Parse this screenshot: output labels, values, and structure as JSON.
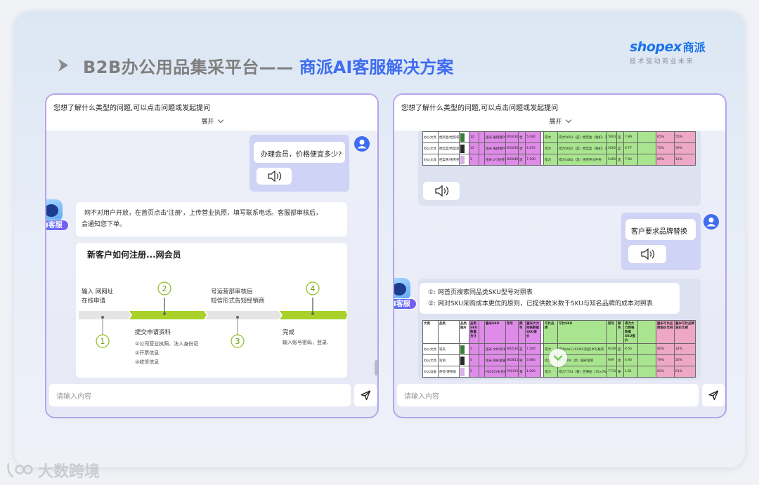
{
  "slide": {
    "title_main": "B2B办公用品集采平台——",
    "title_accent": "商派AI客服解决方案",
    "logo_en": "shopex",
    "logo_cn": "商派",
    "logo_tagline": "技术驱动商业未来"
  },
  "left_panel": {
    "header_prompt": "您想了解什么类型的问题,可以点击问题或发起提问",
    "expand_label": "展开",
    "user_message": "办理会员，价格便宜多少?",
    "ai_badge": "AI客服",
    "bot_reply_line1": "网不对用户开放，在首页点击'注册'，上传营业执照，填写联系电话。客服部审核后，",
    "bot_reply_line2": "会通知您下单。",
    "flow": {
      "title": "新客户如何注册...网会员",
      "step1_label": "输入      网网址",
      "step1_label2": "在线申请",
      "step2_title": "提交申请资料",
      "step2_items": [
        "①公司营业执照、法人身份证",
        "②开票信息",
        "③收货信息"
      ],
      "step3_label": "...",
      "step3_label_a": "号运营部审核后",
      "step3_label_b": "短信形式告知经销商",
      "step4_title": "完成",
      "step4_desc": "输入账号密码，登录.",
      "nums": [
        "1",
        "2",
        "3",
        "4"
      ]
    },
    "input_placeholder": "请输入内容"
  },
  "right_panel": {
    "header_prompt": "您想了解什么类型的问题,可以点击问题或发起提问",
    "expand_label": "展开",
    "top_table": {
      "rows": [
        [
          "办公文具",
          "档案盒/档案袋",
          "",
          "12",
          "",
          "团米 展翔壹PP档案",
          "WG0300",
          "世",
          "5.090",
          "",
          "得力",
          "得力5603（蓝）档案盒（粘扣）25",
          "5603",
          "蓝",
          "7.89",
          "",
          "65%",
          "55%"
        ],
        [
          "办公文具",
          "档案盒/档案袋",
          "",
          "12",
          "",
          "团米 展翔壹PP档案",
          "WG0300",
          "世",
          "4.870",
          "",
          "得力",
          "得力5602（蓝）档案盒（粘扣）35",
          "5602",
          "蓝",
          "6.77",
          "",
          "72%",
          "39%"
        ],
        [
          "办公文具",
          "档案夹/快劳夹",
          "",
          "3",
          "",
          "团米 2寸快劳夹",
          "WG0402",
          "黑",
          "7.100",
          "",
          "得力",
          "得力5481（黑）快劳夹文件夹",
          "5481",
          "黑",
          "7.94",
          "",
          "89%",
          "12%"
        ]
      ]
    },
    "user_message": "客户要求品牌替换",
    "ai_badge": "AI客服",
    "bot_reply_line1": "①:        网首页搜索同品类SKU型号对照表",
    "bot_reply_line2": "②:        网对SKU采购成本更优的原则，已提供数米数千SKU与知名品牌的成本对照表",
    "compare_table": {
      "headers": [
        "大类",
        "品类",
        "品类图片",
        "品类SKU数量合计",
        "",
        "壹米SKU",
        "型号",
        "颜色",
        "壹米大力网格数据SKU报价",
        "",
        "可比品牌",
        "可比SKU",
        "型号",
        "颜色",
        "得力大力网格数据SKU报价",
        "",
        "壹米可比品牌溢价比例",
        "壹米可比品牌溢价比例"
      ],
      "rows": [
        [
          "办公文具",
          "笔夹",
          "",
          "5",
          "",
          "团米 文件袋/拉链",
          "WG5301",
          "蓝",
          "7.200",
          "",
          "得力",
          "得力(da1) 9240(深蓝)书写板夹",
          "9240",
          "蓝",
          "8.56",
          "",
          "80%",
          "24%"
        ],
        [
          "办公文具",
          "笔筒",
          "",
          "4",
          "",
          "团米 圆形金属网",
          "WG8110",
          "银",
          "3.880",
          "",
          "得力",
          "得力909（黑）圆形笔筒",
          "909",
          "黑",
          "4.90",
          "",
          "79%",
          "26%"
        ],
        [
          "办公设备",
          "便签/便笺纸",
          "",
          "2",
          "",
          "P0202Y彩色便签",
          "P0202Y",
          "黄",
          "1.000",
          "",
          "得力",
          "得力7733（黄）百事贴（76×76mm）",
          "7733",
          "黄",
          "1.61",
          "",
          "62%",
          "61%"
        ]
      ]
    },
    "input_placeholder": "请输入内容"
  },
  "watermark": {
    "text": "大数跨境"
  },
  "colors": {
    "accent_blue": "#3f6cf0",
    "panel_border": "#b6a4ea",
    "flow_green": "#a8d12a"
  }
}
